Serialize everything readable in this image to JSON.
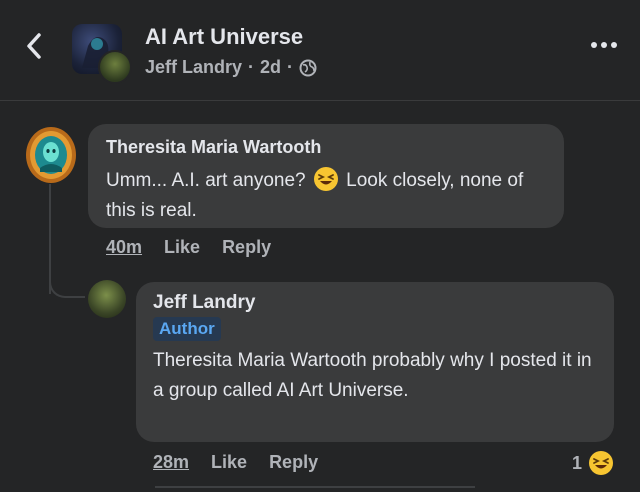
{
  "header": {
    "group_name": "AI Art Universe",
    "author": "Jeff Landry",
    "separator1": "·",
    "age": "2d",
    "separator2": "·"
  },
  "comments": [
    {
      "author": "Theresita Maria Wartooth",
      "text_part1": "Umm... A.I. art anyone?",
      "text_part2": "Look closely, none of this is real.",
      "emoji": "laughing-emoji",
      "time": "40m",
      "like_label": "Like",
      "reply_label": "Reply"
    },
    {
      "author": "Jeff Landry",
      "badge": "Author",
      "text": "Theresita Maria Wartooth probably why I posted it in a group called AI Art Universe.",
      "time": "28m",
      "like_label": "Like",
      "reply_label": "Reply",
      "reaction_count": "1",
      "reaction_icon": "laughing-emoji"
    }
  ],
  "colors": {
    "background": "#242526",
    "bubble": "#3a3b3c",
    "text_primary": "#e4e6eb",
    "text_secondary": "#b0b3b8",
    "author_badge_text": "#5aa7f2",
    "author_badge_bg": "#263951"
  }
}
